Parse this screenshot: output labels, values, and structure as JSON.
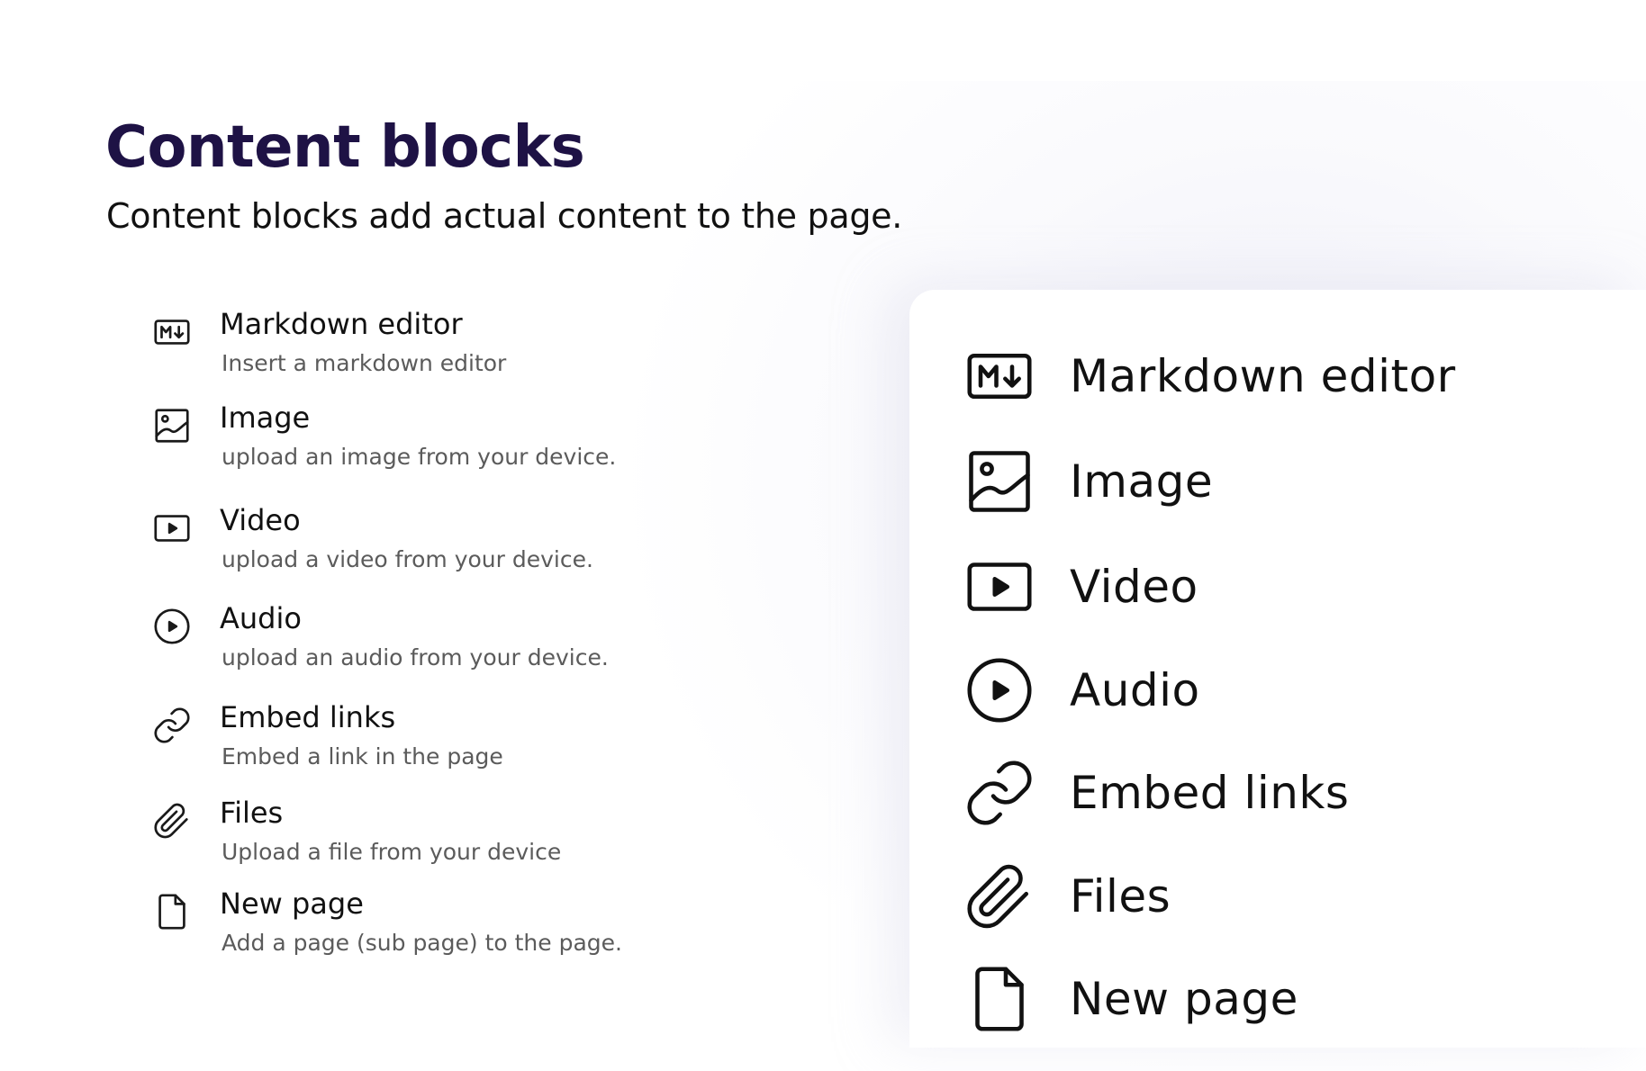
{
  "header": {
    "title": "Content blocks",
    "subtitle": "Content blocks add actual content to the page."
  },
  "blocks": [
    {
      "icon": "markdown-icon",
      "title": "Markdown editor",
      "description": "Insert a markdown editor"
    },
    {
      "icon": "image-icon",
      "title": "Image",
      "description": "upload an image from your device."
    },
    {
      "icon": "video-icon",
      "title": "Video",
      "description": "upload a video from your device."
    },
    {
      "icon": "audio-icon",
      "title": "Audio",
      "description": "upload an audio from your device."
    },
    {
      "icon": "link-icon",
      "title": "Embed links",
      "description": "Embed a link in the page"
    },
    {
      "icon": "paperclip-icon",
      "title": "Files",
      "description": "Upload a file from your device"
    },
    {
      "icon": "file-icon",
      "title": "New page",
      "description": "Add a page (sub page) to the page."
    }
  ],
  "colors": {
    "heading": "#1e1245",
    "text": "#111111",
    "description": "#5b5b5b"
  }
}
